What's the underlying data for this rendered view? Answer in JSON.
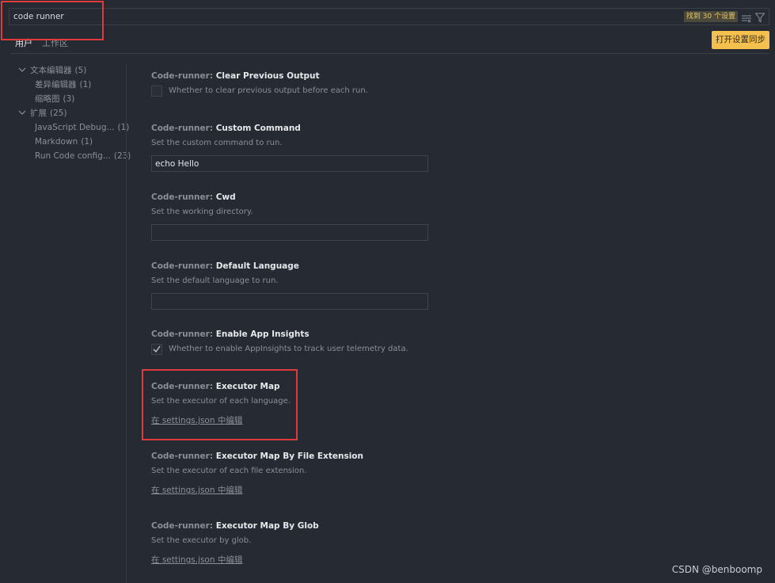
{
  "search": {
    "value": "code runner",
    "results_count": "找到 30 个设置"
  },
  "tabs": [
    {
      "label": "用户"
    },
    {
      "label": "工作区"
    }
  ],
  "sync_button": "打开设置同步",
  "toc": [
    {
      "label": "文本编辑器",
      "count": "(5)"
    },
    {
      "label": "差异编辑器",
      "count": "(1)"
    },
    {
      "label": "缩略图",
      "count": "(3)"
    },
    {
      "label": "扩展",
      "count": "(25)"
    },
    {
      "label": "JavaScript Debug...",
      "count": "(1)"
    },
    {
      "label": "Markdown",
      "count": "(1)"
    },
    {
      "label": "Run Code config...",
      "count": "(23)"
    }
  ],
  "settings": [
    {
      "category": "Code-runner: ",
      "name": "Clear Previous Output",
      "description": "Whether to clear previous output before each run.",
      "checked": false
    },
    {
      "category": "Code-runner: ",
      "name": "Custom Command",
      "description": "Set the custom command to run.",
      "value": "echo Hello"
    },
    {
      "category": "Code-runner: ",
      "name": "Cwd",
      "description": "Set the working directory.",
      "value": ""
    },
    {
      "category": "Code-runner: ",
      "name": "Default Language",
      "description": "Set the default language to run.",
      "value": ""
    },
    {
      "category": "Code-runner: ",
      "name": "Enable App Insights",
      "description": "Whether to enable AppInsights to track user telemetry data.",
      "checked": true
    },
    {
      "category": "Code-runner: ",
      "name": "Executor Map",
      "description": "Set the executor of each language.",
      "link": "在 settings.json 中编辑"
    },
    {
      "category": "Code-runner: ",
      "name": "Executor Map By File Extension",
      "description": "Set the executor of each file extension.",
      "link": "在 settings.json 中编辑"
    },
    {
      "category": "Code-runner: ",
      "name": "Executor Map By Glob",
      "description": "Set the executor by glob.",
      "link": "在 settings.json 中编辑"
    }
  ],
  "watermark": "CSDN @benboomp",
  "colors": {
    "background": "#262a33",
    "highlight": "#e03b3b",
    "sync_button": "#f5c04d"
  }
}
